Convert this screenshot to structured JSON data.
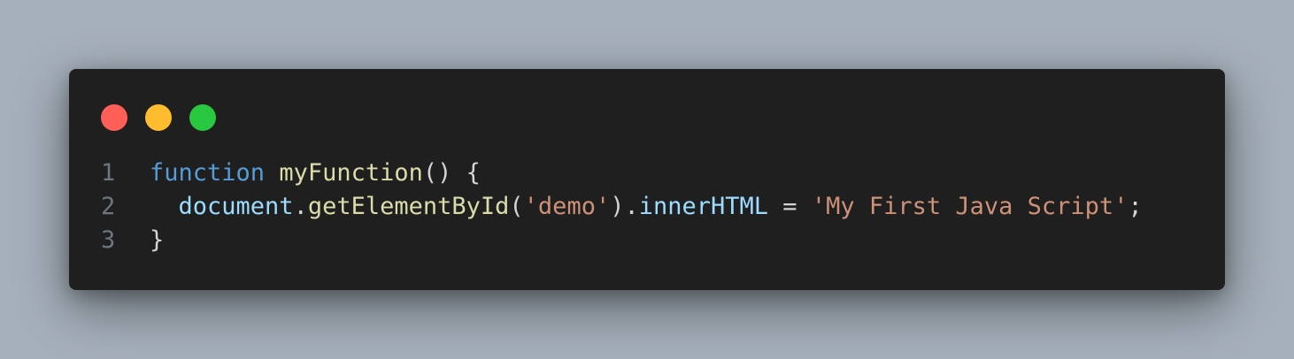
{
  "colors": {
    "background": "#a6b0bb",
    "window": "#1f1f1f",
    "dot_red": "#ff5f57",
    "dot_yellow": "#febc2e",
    "dot_green": "#28c840",
    "line_number": "#6e7681",
    "keyword": "#569cd6",
    "function": "#dcdcaa",
    "variable": "#9cdcfe",
    "string": "#ce9178",
    "default": "#d4d4d4"
  },
  "code_lines": [
    {
      "number": "1",
      "tokens": [
        {
          "text": "function",
          "kind": "keyword"
        },
        {
          "text": " ",
          "kind": "default"
        },
        {
          "text": "myFunction",
          "kind": "function"
        },
        {
          "text": "() {",
          "kind": "default"
        }
      ]
    },
    {
      "number": "2",
      "tokens": [
        {
          "text": "  ",
          "kind": "default"
        },
        {
          "text": "document",
          "kind": "variable"
        },
        {
          "text": ".",
          "kind": "default"
        },
        {
          "text": "getElementById",
          "kind": "function"
        },
        {
          "text": "(",
          "kind": "default"
        },
        {
          "text": "'demo'",
          "kind": "string"
        },
        {
          "text": ").",
          "kind": "default"
        },
        {
          "text": "innerHTML",
          "kind": "variable"
        },
        {
          "text": " = ",
          "kind": "default"
        },
        {
          "text": "'My First Java Script'",
          "kind": "string"
        },
        {
          "text": ";",
          "kind": "default"
        }
      ]
    },
    {
      "number": "3",
      "tokens": [
        {
          "text": "}",
          "kind": "default"
        }
      ]
    }
  ]
}
